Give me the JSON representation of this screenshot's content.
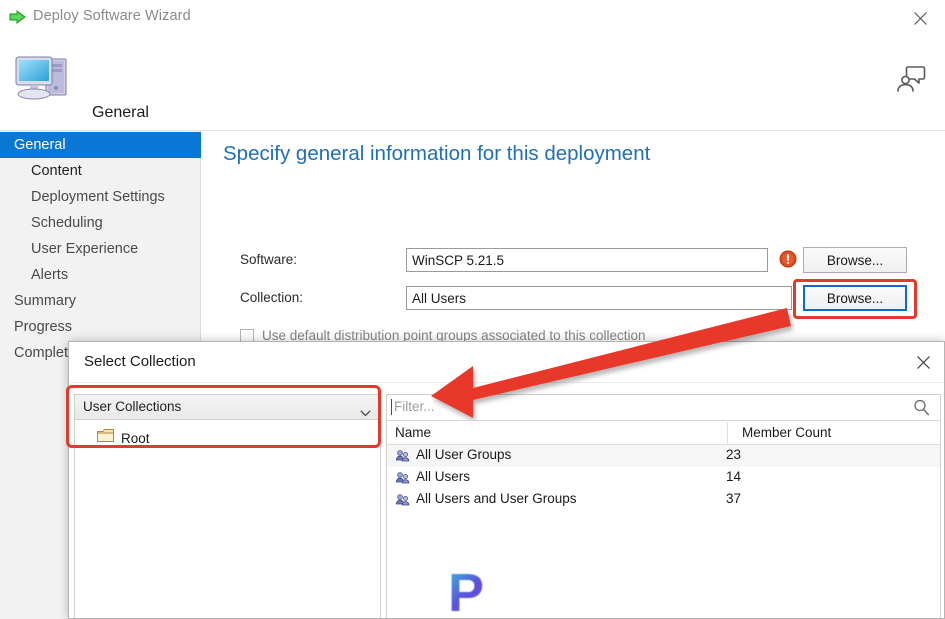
{
  "window": {
    "title": "Deploy Software Wizard",
    "title_icon": "green-arrow-icon",
    "close_label": "✕",
    "header_title": "General",
    "header_icon": "computer-monitor-icon",
    "help_icon": "feedback-person-icon"
  },
  "sidebar": {
    "items": [
      {
        "label": "General",
        "level": 0,
        "selected": true
      },
      {
        "label": "Content",
        "level": 1,
        "selected": false,
        "strong": true
      },
      {
        "label": "Deployment Settings",
        "level": 1,
        "selected": false
      },
      {
        "label": "Scheduling",
        "level": 1,
        "selected": false
      },
      {
        "label": "User Experience",
        "level": 1,
        "selected": false
      },
      {
        "label": "Alerts",
        "level": 1,
        "selected": false
      },
      {
        "label": "Summary",
        "level": 0,
        "selected": false
      },
      {
        "label": "Progress",
        "level": 0,
        "selected": false
      },
      {
        "label": "Completion",
        "level": 0,
        "selected": false
      }
    ]
  },
  "content": {
    "heading": "Specify general information for this deployment",
    "software_label": "Software:",
    "software_value": "WinSCP 5.21.5",
    "software_warning_icon": "error-exclamation-icon",
    "software_browse_label": "Browse...",
    "collection_label": "Collection:",
    "collection_value": "All Users",
    "collection_browse_label": "Browse...",
    "checkbox_label": "Use default distribution point groups associated to this collection"
  },
  "dialog": {
    "title": "Select Collection",
    "close_label": "✕",
    "collection_type": "User Collections",
    "dropdown_icon": "chevron-down-icon",
    "tree_root_label": "Root",
    "tree_root_icon": "folder-icon",
    "filter_placeholder": "Filter...",
    "search_icon": "search-icon",
    "columns": [
      "Name",
      "Member Count"
    ],
    "rows": [
      {
        "name": "All User Groups",
        "count": "23",
        "icon": "collection-icon"
      },
      {
        "name": "All Users",
        "count": "14",
        "icon": "collection-icon"
      },
      {
        "name": "All Users and User Groups",
        "count": "37",
        "icon": "collection-icon"
      }
    ]
  },
  "watermark": {
    "text": "P"
  },
  "annotations": {
    "highlight_color": "#e23b2e",
    "arrow": "points from Collection Browse button to User Collections dropdown"
  }
}
